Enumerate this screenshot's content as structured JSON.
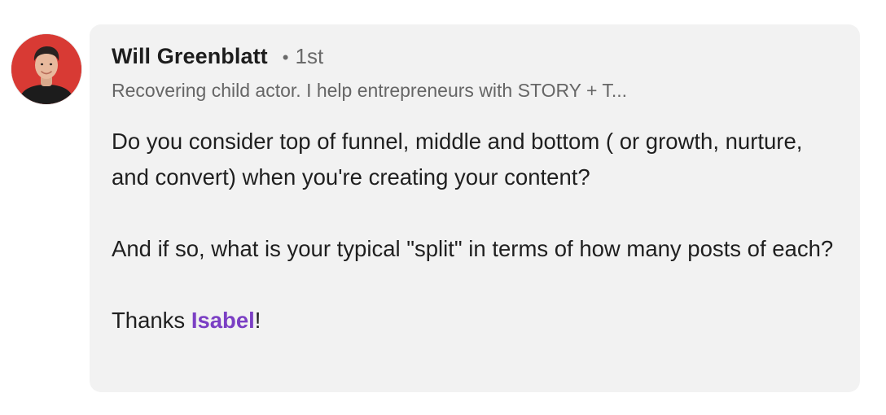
{
  "comment": {
    "author": {
      "name": "Will Greenblatt",
      "degree_separator": "•",
      "degree": "1st",
      "headline": "Recovering child actor. I help entrepreneurs with STORY + T...",
      "avatar_icon": "profile-photo"
    },
    "body": {
      "paragraph_1": "Do you consider top of funnel, middle and bottom ( or growth, nurture, and convert) when you're creating your content?",
      "paragraph_2": "And if so, what is your typical \"split\" in terms of how many posts of each?",
      "thanks_prefix": "Thanks ",
      "mention": "Isabel",
      "thanks_suffix": "!"
    }
  },
  "colors": {
    "bubble_background": "#f2f2f2",
    "mention": "#7b3fc4",
    "avatar_background": "#d83a34",
    "secondary_text": "#666666"
  }
}
